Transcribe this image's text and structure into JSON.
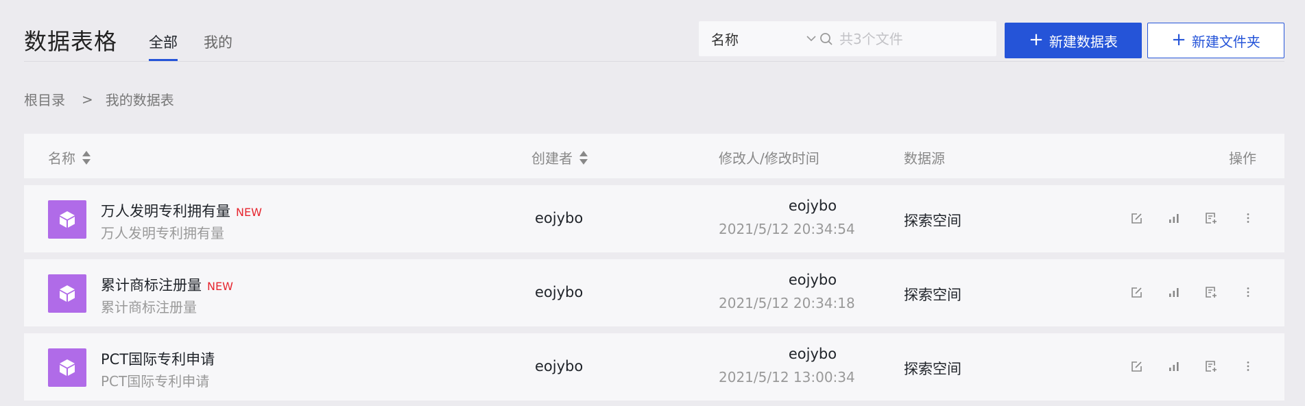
{
  "header": {
    "title": "数据表格",
    "tabs": [
      {
        "label": "全部",
        "active": true
      },
      {
        "label": "我的",
        "active": false
      }
    ],
    "filter": {
      "select_value": "名称",
      "search_placeholder": "共3个文件"
    },
    "buttons": {
      "new_table": "新建数据表",
      "new_folder": "新建文件夹"
    }
  },
  "breadcrumb": {
    "root": "根目录",
    "separator": ">",
    "current": "我的数据表"
  },
  "table": {
    "columns": {
      "name": "名称",
      "creator": "创建者",
      "modified": "修改人/修改时间",
      "source": "数据源",
      "actions": "操作"
    },
    "rows": [
      {
        "name": "万人发明专利拥有量",
        "sub": "万人发明专利拥有量",
        "badge": "NEW",
        "creator": "eojybo",
        "modifier": "eojybo",
        "time": "2021/5/12 20:34:54",
        "source": "探索空间"
      },
      {
        "name": "累计商标注册量",
        "sub": "累计商标注册量",
        "badge": "NEW",
        "creator": "eojybo",
        "modifier": "eojybo",
        "time": "2021/5/12 20:34:18",
        "source": "探索空间"
      },
      {
        "name": "PCT国际专利申请",
        "sub": "PCT国际专利申请",
        "badge": "",
        "creator": "eojybo",
        "modifier": "eojybo",
        "time": "2021/5/12 13:00:34",
        "source": "探索空间"
      }
    ]
  },
  "colors": {
    "primary": "#2554d8",
    "badge": "#e6262f",
    "icon_bg": "#b06be8",
    "background": "#ecebef"
  },
  "icons": [
    "chevron-down-icon",
    "search-icon",
    "plus-icon",
    "sort-icon",
    "cube-icon",
    "edit-icon",
    "chart-icon",
    "add-list-icon",
    "more-icon"
  ]
}
